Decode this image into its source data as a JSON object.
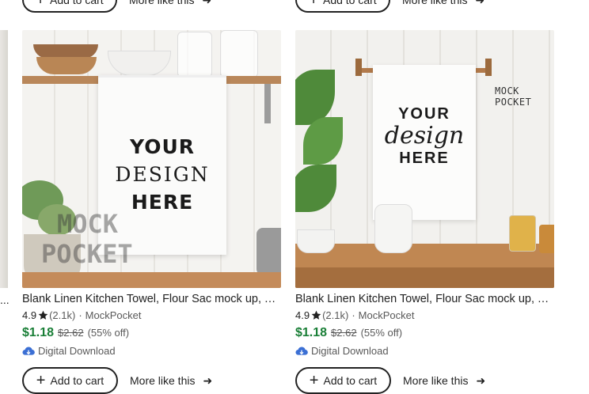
{
  "top_row": {
    "add_to_cart_label": "Add to cart",
    "more_like_this_label": "More like this"
  },
  "left_partial": {
    "text": "..."
  },
  "cards": [
    {
      "image": {
        "text_line1": "YOUR",
        "text_line2": "DESIGN",
        "text_line3": "HERE",
        "watermark_line1": "MOCK",
        "watermark_line2": "POCKET"
      },
      "title": "Blank Linen Kitchen Towel, Flour Sac mock up, Tea Towel mockup",
      "rating": "4.9",
      "reviews": "(2.1k)",
      "separator": "·",
      "shop": "MockPocket",
      "price": "$1.18",
      "original_price": "$2.62",
      "discount": "(55% off)",
      "download_label": "Digital Download",
      "add_to_cart_label": "Add to cart",
      "more_like_this_label": "More like this"
    },
    {
      "image": {
        "text_line1": "YOUR",
        "text_line2": "design",
        "text_line3": "HERE",
        "watermark": "MOCK POCKET"
      },
      "title": "Blank Linen Kitchen Towel, Flour Sac mock up, Tea Towel mockup",
      "rating": "4.9",
      "reviews": "(2.1k)",
      "separator": "·",
      "shop": "MockPocket",
      "price": "$1.18",
      "original_price": "$2.62",
      "discount": "(55% off)",
      "download_label": "Digital Download",
      "add_to_cart_label": "Add to cart",
      "more_like_this_label": "More like this"
    }
  ],
  "colors": {
    "price": "#1a7f37",
    "text": "#222222",
    "muted": "#595959",
    "download_icon": "#3b6fd4"
  },
  "icons": {
    "star": "star-icon",
    "plus": "plus-icon",
    "arrow": "arrow-right-icon",
    "download": "cloud-download-icon"
  }
}
